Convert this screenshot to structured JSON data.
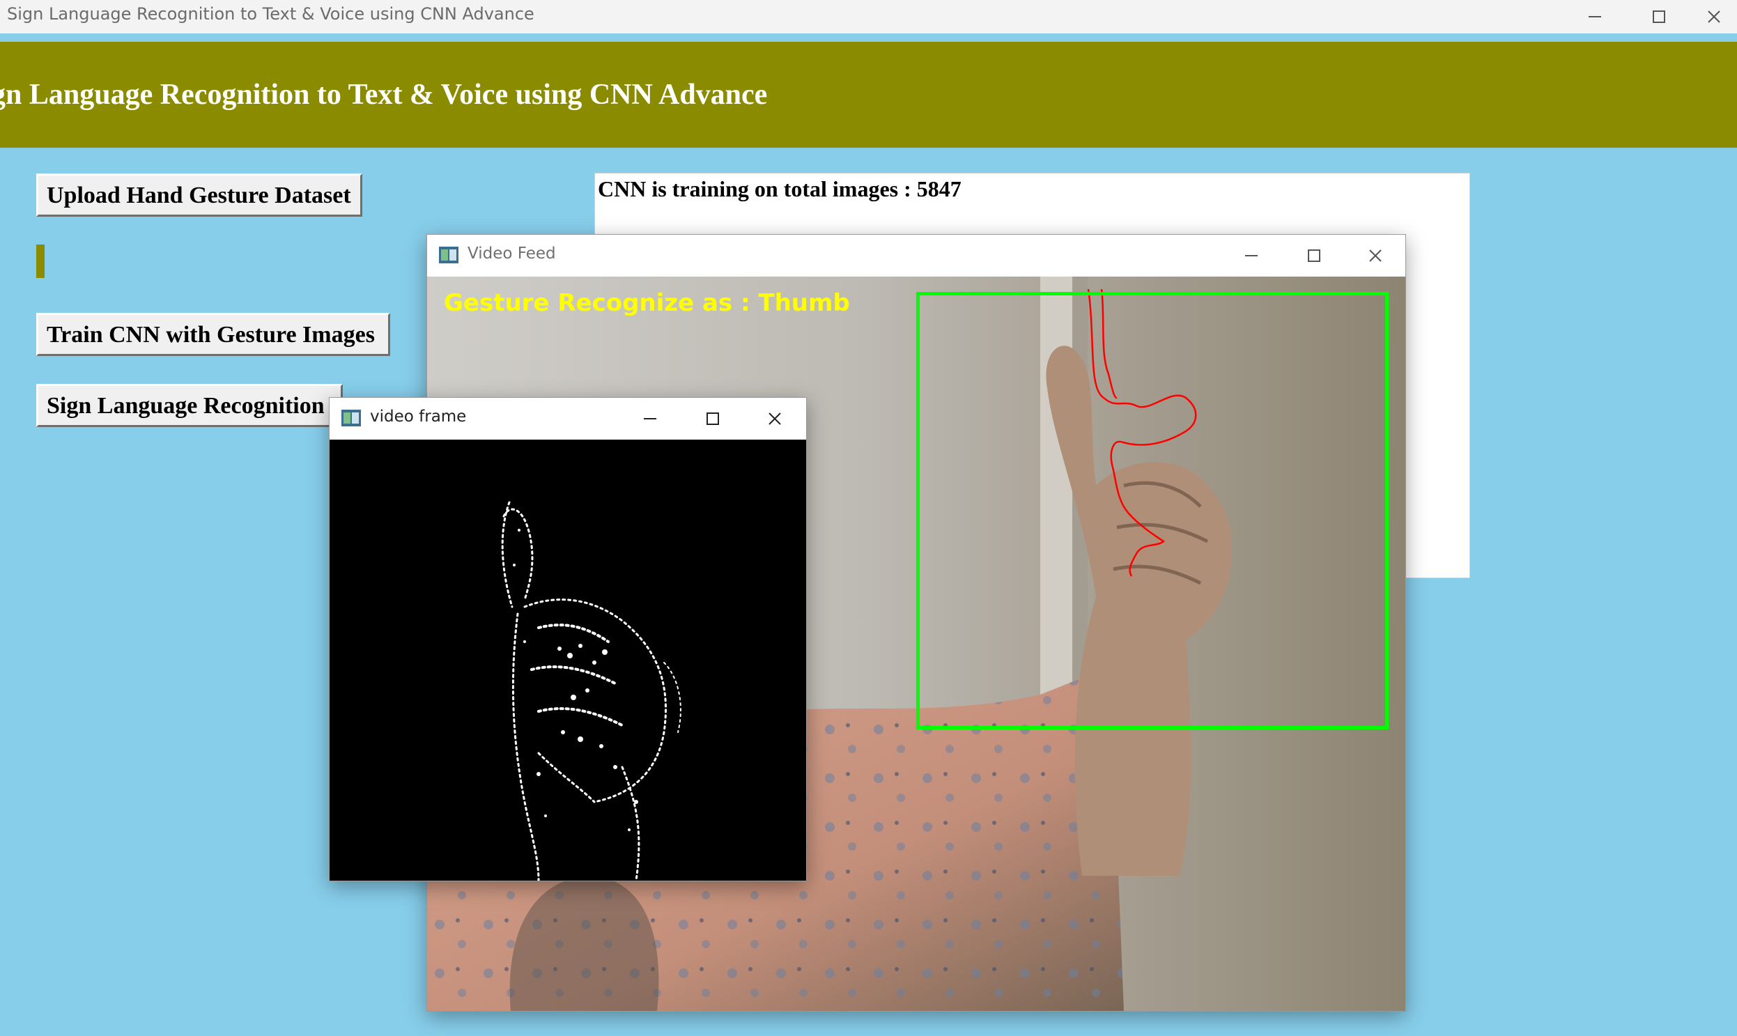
{
  "window": {
    "title": "Sign Language Recognition to Text & Voice using CNN Advance"
  },
  "banner": {
    "title": "Sign Language Recognition to Text & Voice using CNN Advance"
  },
  "buttons": {
    "upload": "Upload Hand Gesture Dataset",
    "train": "Train CNN with Gesture Images",
    "recognize": "Sign Language Recognition"
  },
  "output": {
    "line1": "CNN is training on total images : 5847"
  },
  "video_feed": {
    "title": "Video Feed",
    "overlay_text": "Gesture Recognize as : Thumb"
  },
  "video_frame": {
    "title": "video frame"
  },
  "colors": {
    "background": "#87ceeb",
    "banner": "#8b8b00",
    "roi_box": "#00ff00",
    "overlay_text": "#ffff00",
    "contour": "#ff0000"
  },
  "icons": [
    "minimize-icon",
    "maximize-icon",
    "close-icon",
    "opencv-window-icon"
  ]
}
